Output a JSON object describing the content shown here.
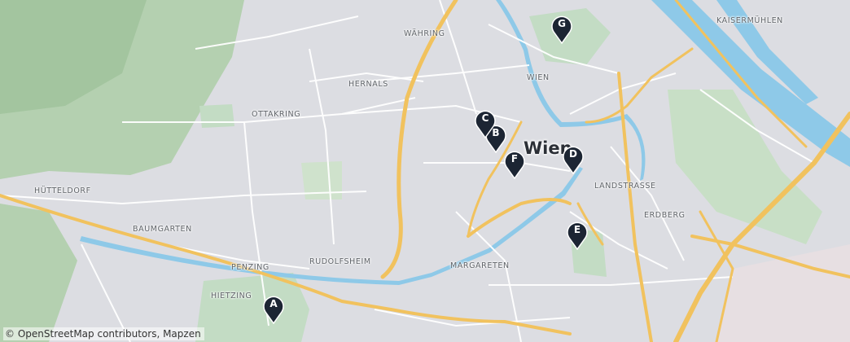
{
  "map": {
    "city_label": "Wien",
    "district_labels": [
      {
        "key": "waehring",
        "text": "WÄHRING"
      },
      {
        "key": "hernals",
        "text": "HERNALS"
      },
      {
        "key": "ottakring",
        "text": "OTTAKRING"
      },
      {
        "key": "huetteldorf",
        "text": "HÜTTELDORF"
      },
      {
        "key": "baumgarten",
        "text": "BAUMGARTEN"
      },
      {
        "key": "penzing",
        "text": "PENZING"
      },
      {
        "key": "rudolfsheim",
        "text": "RUDOLFSHEIM"
      },
      {
        "key": "hietzing",
        "text": "HIETZING"
      },
      {
        "key": "margareten",
        "text": "MARGARETEN"
      },
      {
        "key": "landstrasse",
        "text": "LANDSTRASSE"
      },
      {
        "key": "erdberg",
        "text": "ERDBERG"
      },
      {
        "key": "kaisermuehlen",
        "text": "KAISERMÜHLEN"
      },
      {
        "key": "wien_small",
        "text": "WIEN"
      }
    ],
    "markers": [
      "A",
      "B",
      "C",
      "D",
      "E",
      "F",
      "G"
    ],
    "attribution": "© OpenStreetMap contributors, Mapzen",
    "colors": {
      "background": "#dcdde2",
      "park": "#c3dcc4",
      "forest": "#a9c9a4",
      "water": "#8ec9e8",
      "highway": "#f1c25e",
      "road": "#ffffff",
      "marker": "#1c2533"
    }
  }
}
